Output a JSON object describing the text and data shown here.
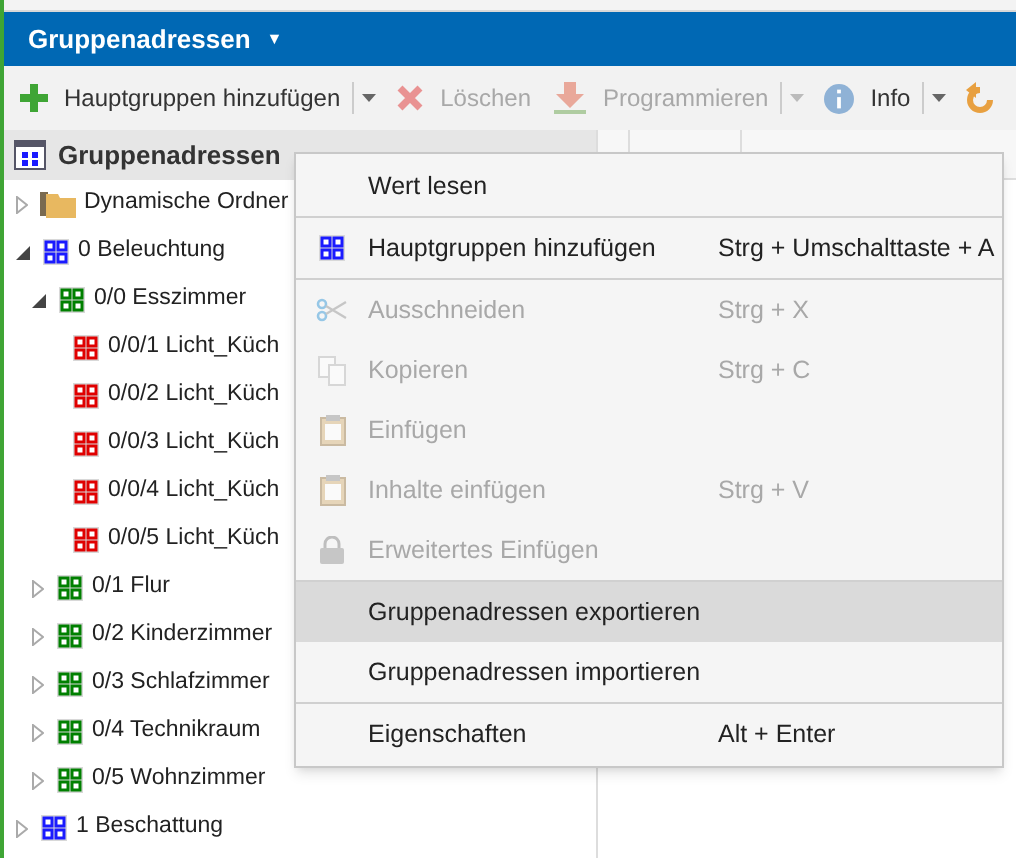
{
  "panel": {
    "title": "Gruppenadressen",
    "caret": "▼"
  },
  "toolbar": [
    {
      "kind": "add",
      "label": "Hauptgruppen hinzufügen",
      "disabled": false,
      "dropdown": true
    },
    {
      "kind": "delete",
      "label": "Löschen",
      "disabled": true,
      "dropdown": false
    },
    {
      "kind": "program",
      "label": "Programmieren",
      "disabled": true,
      "dropdown": true
    },
    {
      "kind": "info",
      "label": "Info",
      "disabled": false,
      "dropdown": true
    },
    {
      "kind": "undo",
      "disabled": false,
      "dropdown": false
    }
  ],
  "tree": {
    "header": "Gruppenadressen",
    "items": [
      {
        "kind": "folder",
        "label": "Dynamische Ordner",
        "expanded": false
      },
      {
        "kind": "main",
        "label": "0 Beleuchtung",
        "expanded": true,
        "children": [
          {
            "kind": "middle",
            "label": "0/0 Esszimmer",
            "expanded": true,
            "children": [
              {
                "kind": "group",
                "label": "0/0/1 Licht_Küch"
              },
              {
                "kind": "group",
                "label": "0/0/2 Licht_Küch"
              },
              {
                "kind": "group",
                "label": "0/0/3 Licht_Küch"
              },
              {
                "kind": "group",
                "label": "0/0/4 Licht_Küch"
              },
              {
                "kind": "group",
                "label": "0/0/5 Licht_Küch"
              }
            ]
          },
          {
            "kind": "middle",
            "label": "0/1 Flur",
            "expanded": false
          },
          {
            "kind": "middle",
            "label": "0/2 Kinderzimmer",
            "expanded": false
          },
          {
            "kind": "middle",
            "label": "0/3 Schlafzimmer",
            "expanded": false
          },
          {
            "kind": "middle",
            "label": "0/4 Technikraum",
            "expanded": false
          },
          {
            "kind": "middle",
            "label": "0/5 Wohnzimmer",
            "expanded": false
          }
        ]
      },
      {
        "kind": "main",
        "label": "1 Beschattung",
        "expanded": false
      }
    ]
  },
  "context_menu": [
    {
      "kind": "plain",
      "label": "Wert lesen",
      "disabled": false,
      "selected": false
    },
    {
      "kind": "separator"
    },
    {
      "kind": "add_group",
      "label": "Hauptgruppen hinzufügen",
      "shortcut": "Strg + Umschalttaste + A",
      "disabled": false,
      "selected": false
    },
    {
      "kind": "separator"
    },
    {
      "kind": "cut",
      "label": "Ausschneiden",
      "shortcut": "Strg + X",
      "disabled": true,
      "selected": false
    },
    {
      "kind": "copy",
      "label": "Kopieren",
      "shortcut": "Strg + C",
      "disabled": true,
      "selected": false
    },
    {
      "kind": "paste",
      "label": "Einfügen",
      "disabled": true,
      "selected": false
    },
    {
      "kind": "paste",
      "label": "Inhalte einfügen",
      "shortcut": "Strg + V",
      "disabled": true,
      "selected": false
    },
    {
      "kind": "paste_special",
      "label": "Erweitertes Einfügen",
      "disabled": true,
      "selected": false
    },
    {
      "kind": "separator"
    },
    {
      "kind": "plain",
      "label": "Gruppenadressen exportieren",
      "disabled": false,
      "selected": true
    },
    {
      "kind": "plain",
      "label": "Gruppenadressen importieren",
      "disabled": false,
      "selected": false
    },
    {
      "kind": "separator"
    },
    {
      "kind": "plain",
      "label": "Eigenschaften",
      "shortcut": "Alt + Enter",
      "disabled": false,
      "selected": false
    }
  ]
}
